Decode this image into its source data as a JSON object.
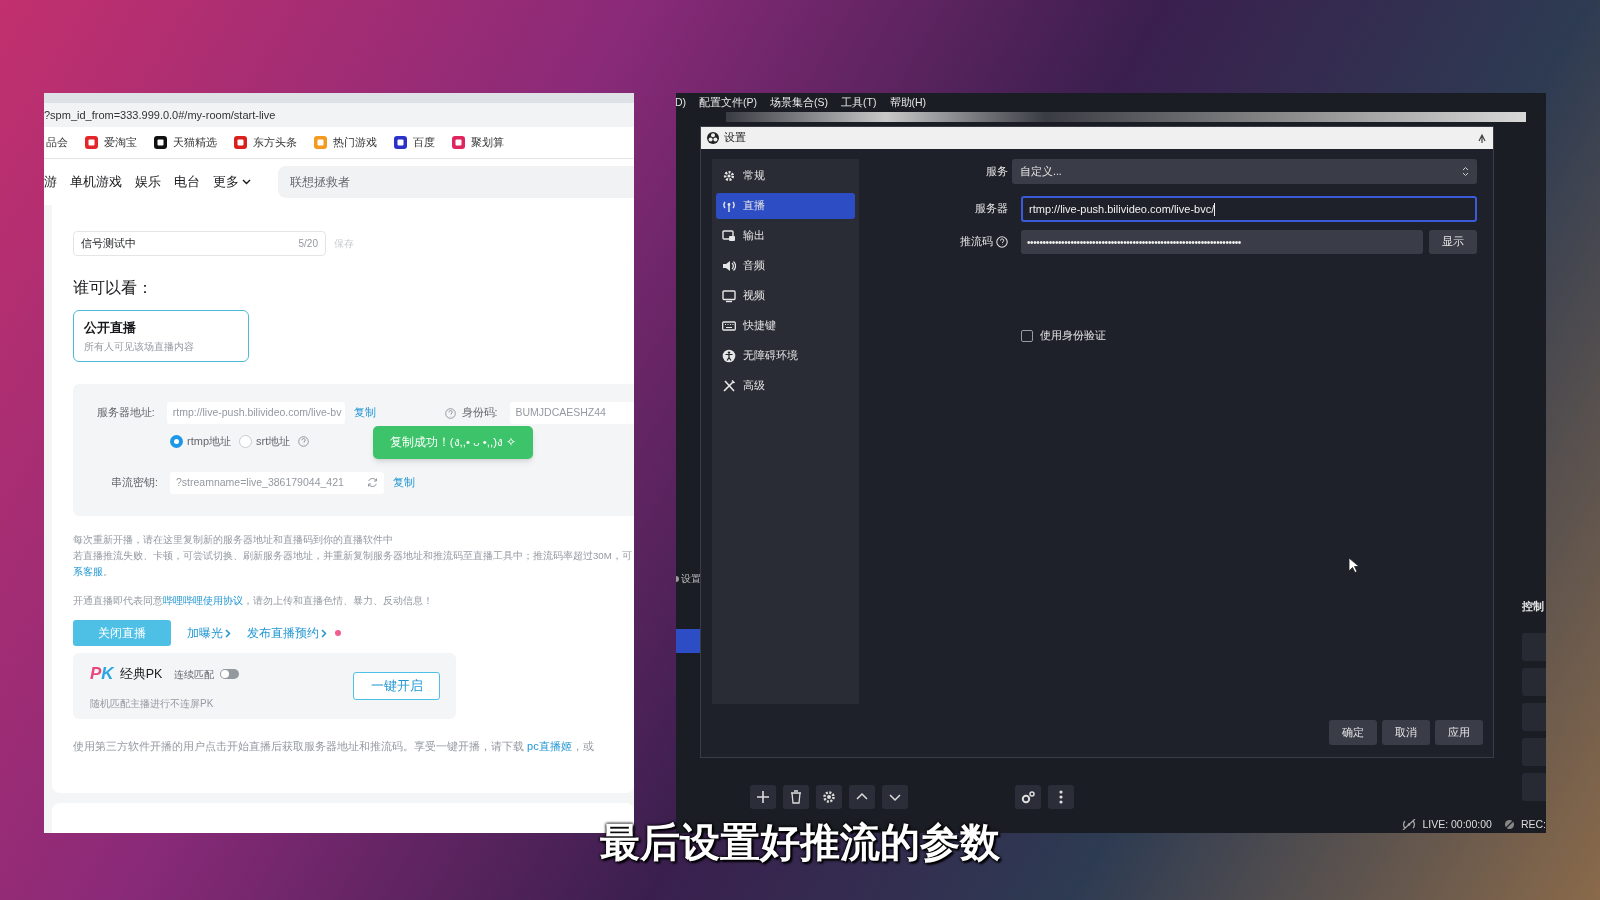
{
  "browser": {
    "url": "?spm_id_from=333.999.0.0#/my-room/start-live",
    "bookmarks": [
      {
        "label": "品会"
      },
      {
        "label": "爱淘宝",
        "color": "#e4262b"
      },
      {
        "label": "天猫精选",
        "color": "#111111"
      },
      {
        "label": "东方头条",
        "color": "#d9201c"
      },
      {
        "label": "热门游戏",
        "color": "#f39a1f"
      },
      {
        "label": "百度",
        "color": "#2a32c8"
      },
      {
        "label": "聚划算",
        "color": "#e0245e"
      }
    ],
    "nav": [
      {
        "label": "游",
        "kind": "link"
      },
      {
        "label": "单机游戏",
        "kind": "link"
      },
      {
        "label": "娱乐",
        "kind": "link"
      },
      {
        "label": "电台",
        "kind": "link"
      },
      {
        "label": "更多",
        "kind": "dropdown"
      }
    ],
    "search": {
      "placeholder": "联想拯救者"
    },
    "title_field": {
      "value": "信号测试中",
      "counter": "5/20",
      "save": "保存"
    },
    "audience": {
      "heading": "谁可以看：",
      "options": [
        {
          "title": "公开直播",
          "desc": "所有人可见该场直播内容",
          "selected": true
        }
      ]
    },
    "stream_panel": {
      "server_label": "服务器地址:",
      "server_value": "rtmp://live-push.bilivideo.com/live-bv",
      "copy": "复制",
      "id_label": "身份码:",
      "id_value": "BUMJDCAESHZ44",
      "radios": [
        {
          "label": "rtmp地址",
          "selected": true
        },
        {
          "label": "srt地址",
          "selected": false
        }
      ],
      "key_label": "串流密钥:",
      "key_value": "?streamname=live_386179044_421",
      "key_copy": "复制"
    },
    "toast": "复制成功！(ง,,• ᴗ •,,)ง ✧",
    "notes": [
      [
        {
          "text": "每次重新开播，请在这里复制新的服务器地址和直播码到你的直播软件中",
          "link": false
        }
      ],
      [
        {
          "text": "若直播推流失败、卡顿，可尝试切换、刷新服务器地址，并重新复制服务器地址和推流码至直播工具中；推流码率超过30M，可",
          "link": false
        }
      ],
      [
        {
          "text": "系客服",
          "link": true
        },
        {
          "text": "。",
          "link": false
        }
      ]
    ],
    "agreement": [
      {
        "text": "开通直播即代表同意",
        "link": false
      },
      {
        "text": "哔哩哔哩使用协议",
        "link": true
      },
      {
        "text": "，请勿上传和直播色情、暴力、反动信息！",
        "link": false
      }
    ],
    "close_button": "关闭直播",
    "action_links": [
      {
        "label": "加曝光",
        "dot": false
      },
      {
        "label": "发布直播预约",
        "dot": true
      }
    ],
    "pk": {
      "logo": "PK",
      "title": "经典PK",
      "toggle_label": "连续匹配",
      "toggle_on": false,
      "desc": "随机匹配主播进行不连屏PK",
      "button": "一键开启"
    },
    "footer": [
      {
        "text": "使用第三方软件开播的用户点击开始直播后获取服务器地址和推流码。享受一键开播，请下载 ",
        "link": false
      },
      {
        "text": "pc直播姬",
        "link": true
      },
      {
        "text": "，或",
        "link": false
      }
    ]
  },
  "obs": {
    "menu": [
      "D)",
      "配置文件(P)",
      "场景集合(S)",
      "工具(T)",
      "帮助(H)"
    ],
    "dock_label": "设置",
    "control_label": "控制",
    "live": "LIVE: 00:00:00",
    "rec": "REC:",
    "dialog": {
      "title": "设置",
      "sidebar": [
        {
          "label": "常规",
          "selected": false
        },
        {
          "label": "直播",
          "selected": true
        },
        {
          "label": "输出",
          "selected": false
        },
        {
          "label": "音频",
          "selected": false
        },
        {
          "label": "视频",
          "selected": false
        },
        {
          "label": "快捷键",
          "selected": false
        },
        {
          "label": "无障碍环境",
          "selected": false
        },
        {
          "label": "高级",
          "selected": false
        }
      ],
      "service_label": "服务",
      "service_value": "自定义...",
      "server_label": "服务器",
      "server_value": "rtmp://live-push.bilivideo.com/live-bvc/",
      "key_label": "推流码",
      "key_value": "•••••••••••••••••••••••••••••••••••••••••••••••••••••••••••••••••••••",
      "show_button": "显示",
      "auth": {
        "label": "使用身份验证",
        "checked": false
      },
      "buttons": [
        "确定",
        "取消",
        "应用"
      ]
    }
  },
  "subtitle": "最后设置好推流的参数"
}
